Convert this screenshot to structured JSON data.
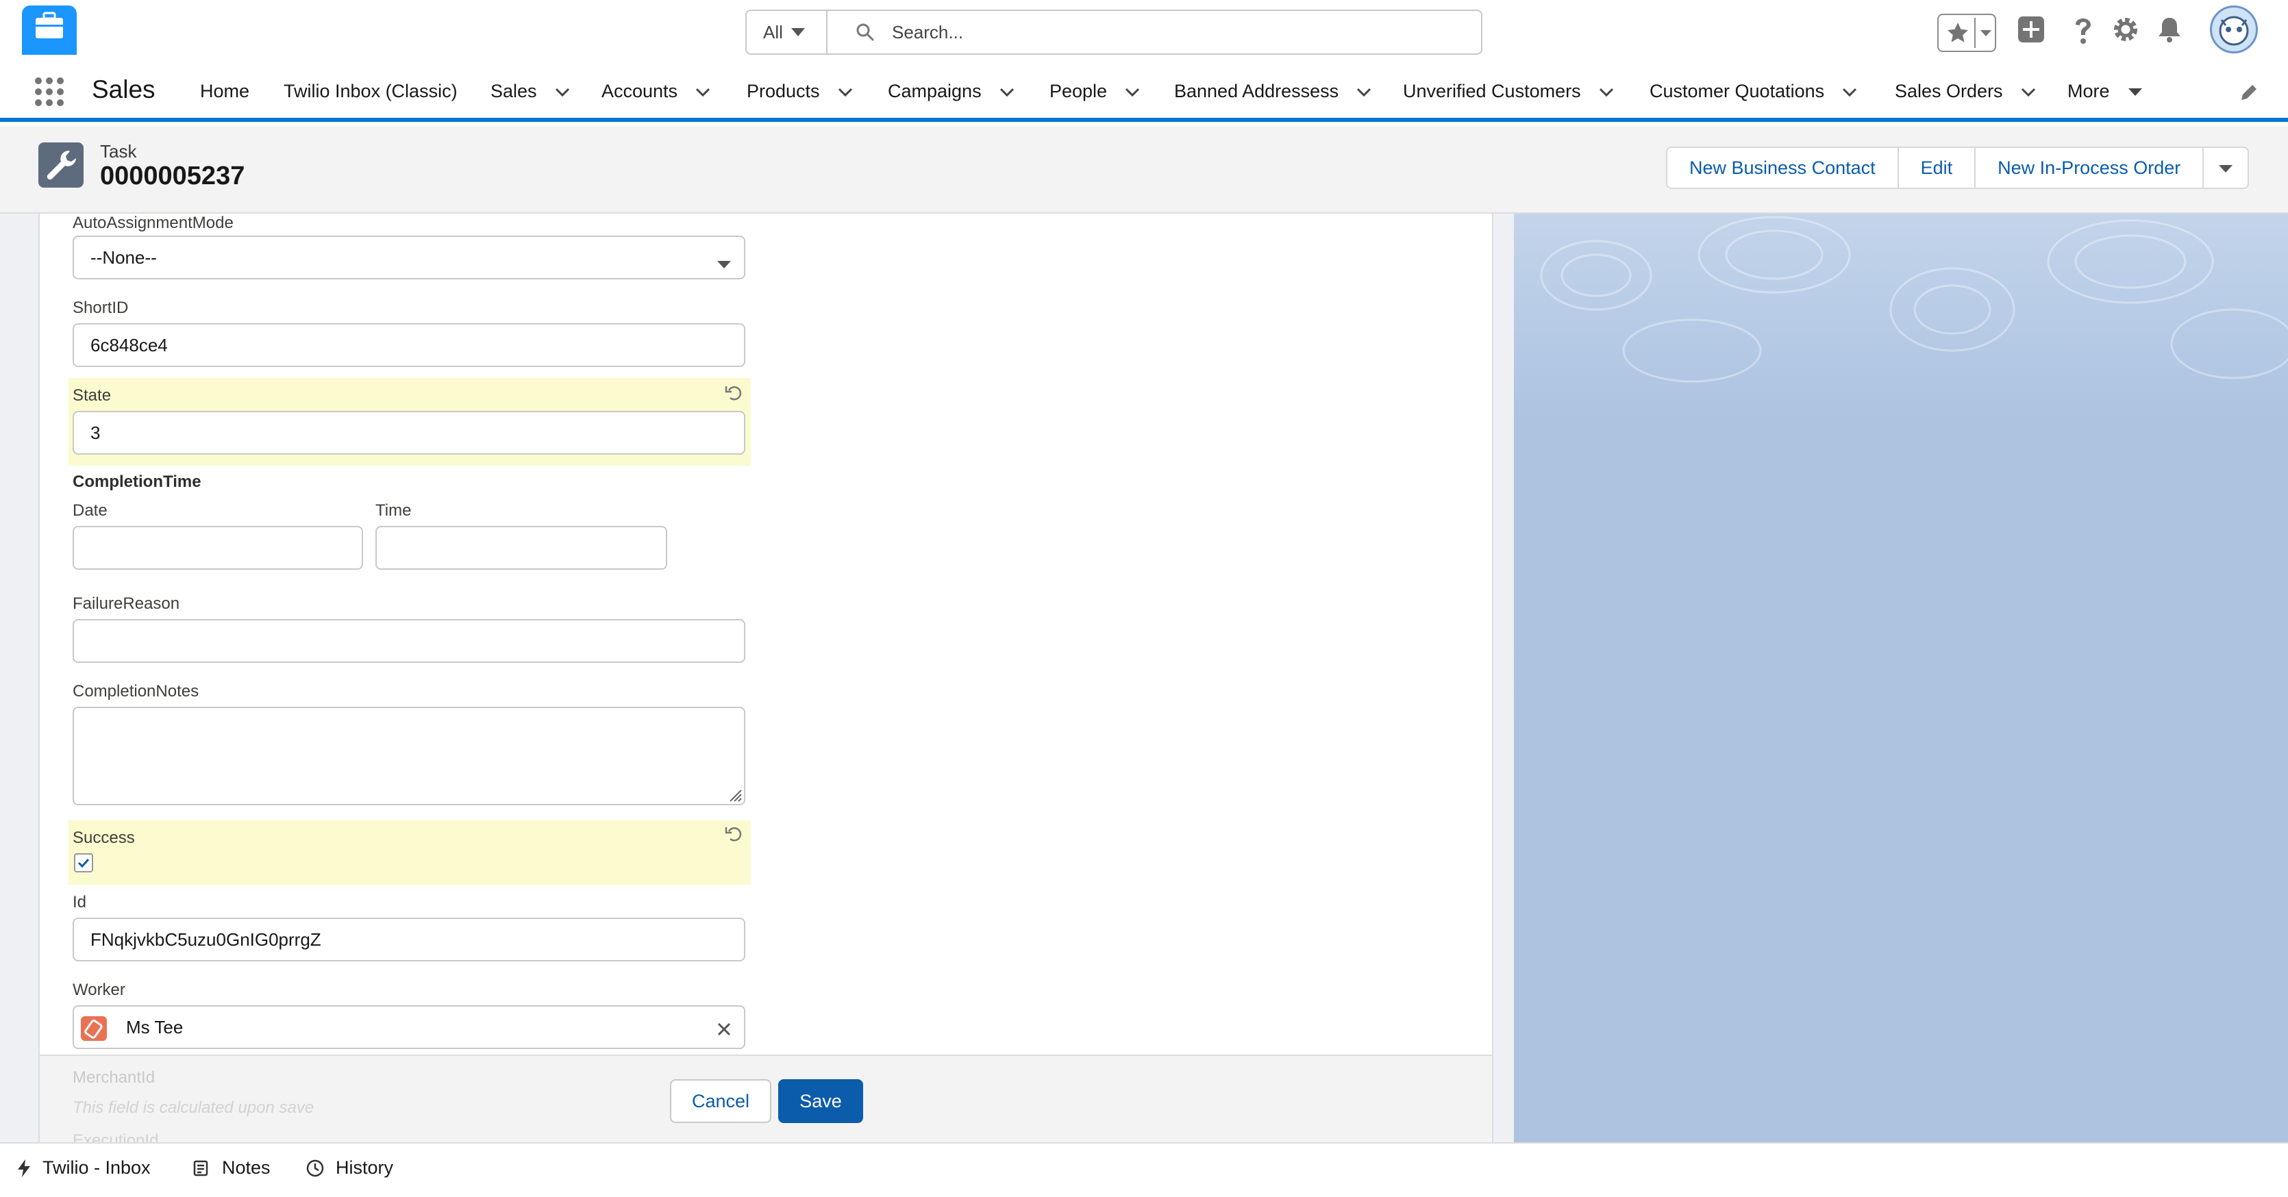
{
  "global_header": {
    "search_scope": "All",
    "search_placeholder": "Search..."
  },
  "nav": {
    "app_name": "Sales",
    "items": [
      {
        "label": "Home",
        "has_menu": false
      },
      {
        "label": "Twilio Inbox (Classic)",
        "has_menu": false
      },
      {
        "label": "Sales",
        "has_menu": true
      },
      {
        "label": "Accounts",
        "has_menu": true
      },
      {
        "label": "Products",
        "has_menu": true
      },
      {
        "label": "Campaigns",
        "has_menu": true
      },
      {
        "label": "People",
        "has_menu": true
      },
      {
        "label": "Banned Addressess",
        "has_menu": true
      },
      {
        "label": "Unverified Customers",
        "has_menu": true
      },
      {
        "label": "Customer Quotations",
        "has_menu": true
      },
      {
        "label": "Sales Orders",
        "has_menu": true
      },
      {
        "label": "More",
        "has_menu": true
      }
    ]
  },
  "record": {
    "type": "Task",
    "title": "0000005237",
    "actions": [
      "New Business Contact",
      "Edit",
      "New In-Process Order"
    ]
  },
  "form": {
    "auto_assignment_mode": {
      "label": "AutoAssignmentMode",
      "value": "--None--"
    },
    "short_id": {
      "label": "ShortID",
      "value": "6c848ce4"
    },
    "state": {
      "label": "State",
      "value": "3"
    },
    "completion_time": {
      "label": "CompletionTime",
      "date_label": "Date",
      "time_label": "Time",
      "date_value": "",
      "time_value": ""
    },
    "failure_reason": {
      "label": "FailureReason",
      "value": ""
    },
    "completion_notes": {
      "label": "CompletionNotes",
      "value": ""
    },
    "success": {
      "label": "Success",
      "checked": true
    },
    "id": {
      "label": "Id",
      "value": "FNqkjvkbC5uzu0GnIG0prrgZ"
    },
    "worker": {
      "label": "Worker",
      "value": "Ms Tee"
    },
    "merchant_id": {
      "label": "MerchantId",
      "note": "This field is calculated upon save"
    },
    "cut_off_label": "ExecutionId"
  },
  "footer": {
    "cancel": "Cancel",
    "save": "Save"
  },
  "utility_bar": {
    "items": [
      "Twilio - Inbox",
      "Notes",
      "History"
    ]
  },
  "colors": {
    "brand_blue": "#0176d3",
    "button_blue": "#0b5cab",
    "highlight_yellow": "#fbfbcf"
  }
}
